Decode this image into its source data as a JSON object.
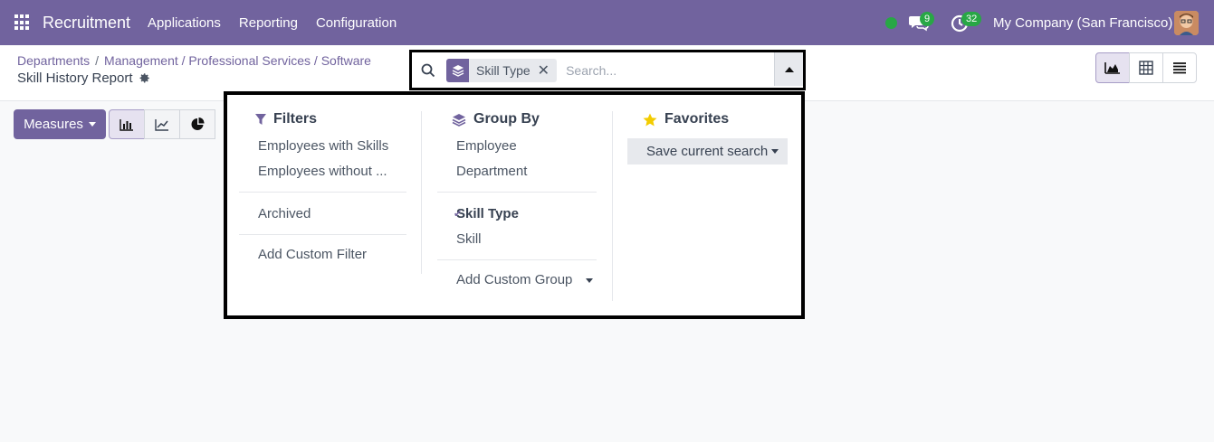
{
  "navbar": {
    "app_name": "Recruitment",
    "menu": [
      "Applications",
      "Reporting",
      "Configuration"
    ],
    "chat_count": "9",
    "activity_count": "32",
    "company": "My Company (San Francisco)",
    "accent": "#71639e"
  },
  "breadcrumb": {
    "items": [
      "Departments",
      "Management / Professional Services / Software"
    ],
    "separator": "/",
    "title": "Skill History Report"
  },
  "search": {
    "facet_label": "Skill Type",
    "facet_icon": "layers-icon",
    "placeholder": "Search..."
  },
  "toolbar": {
    "measures_label": "Measures",
    "chart_buttons": [
      "bar-chart-icon",
      "line-chart-icon",
      "pie-chart-icon"
    ],
    "views": [
      "graph-icon",
      "pivot-icon",
      "list-icon"
    ]
  },
  "filters": {
    "title": "Filters",
    "items": [
      "Employees with Skills",
      "Employees without ..."
    ],
    "archived": "Archived",
    "custom": "Add Custom Filter"
  },
  "group_by": {
    "title": "Group By",
    "items": [
      "Employee",
      "Department"
    ],
    "items2": [
      "Skill Type",
      "Skill"
    ],
    "custom": "Add Custom Group"
  },
  "favorites": {
    "title": "Favorites",
    "save_label": "Save current search"
  }
}
